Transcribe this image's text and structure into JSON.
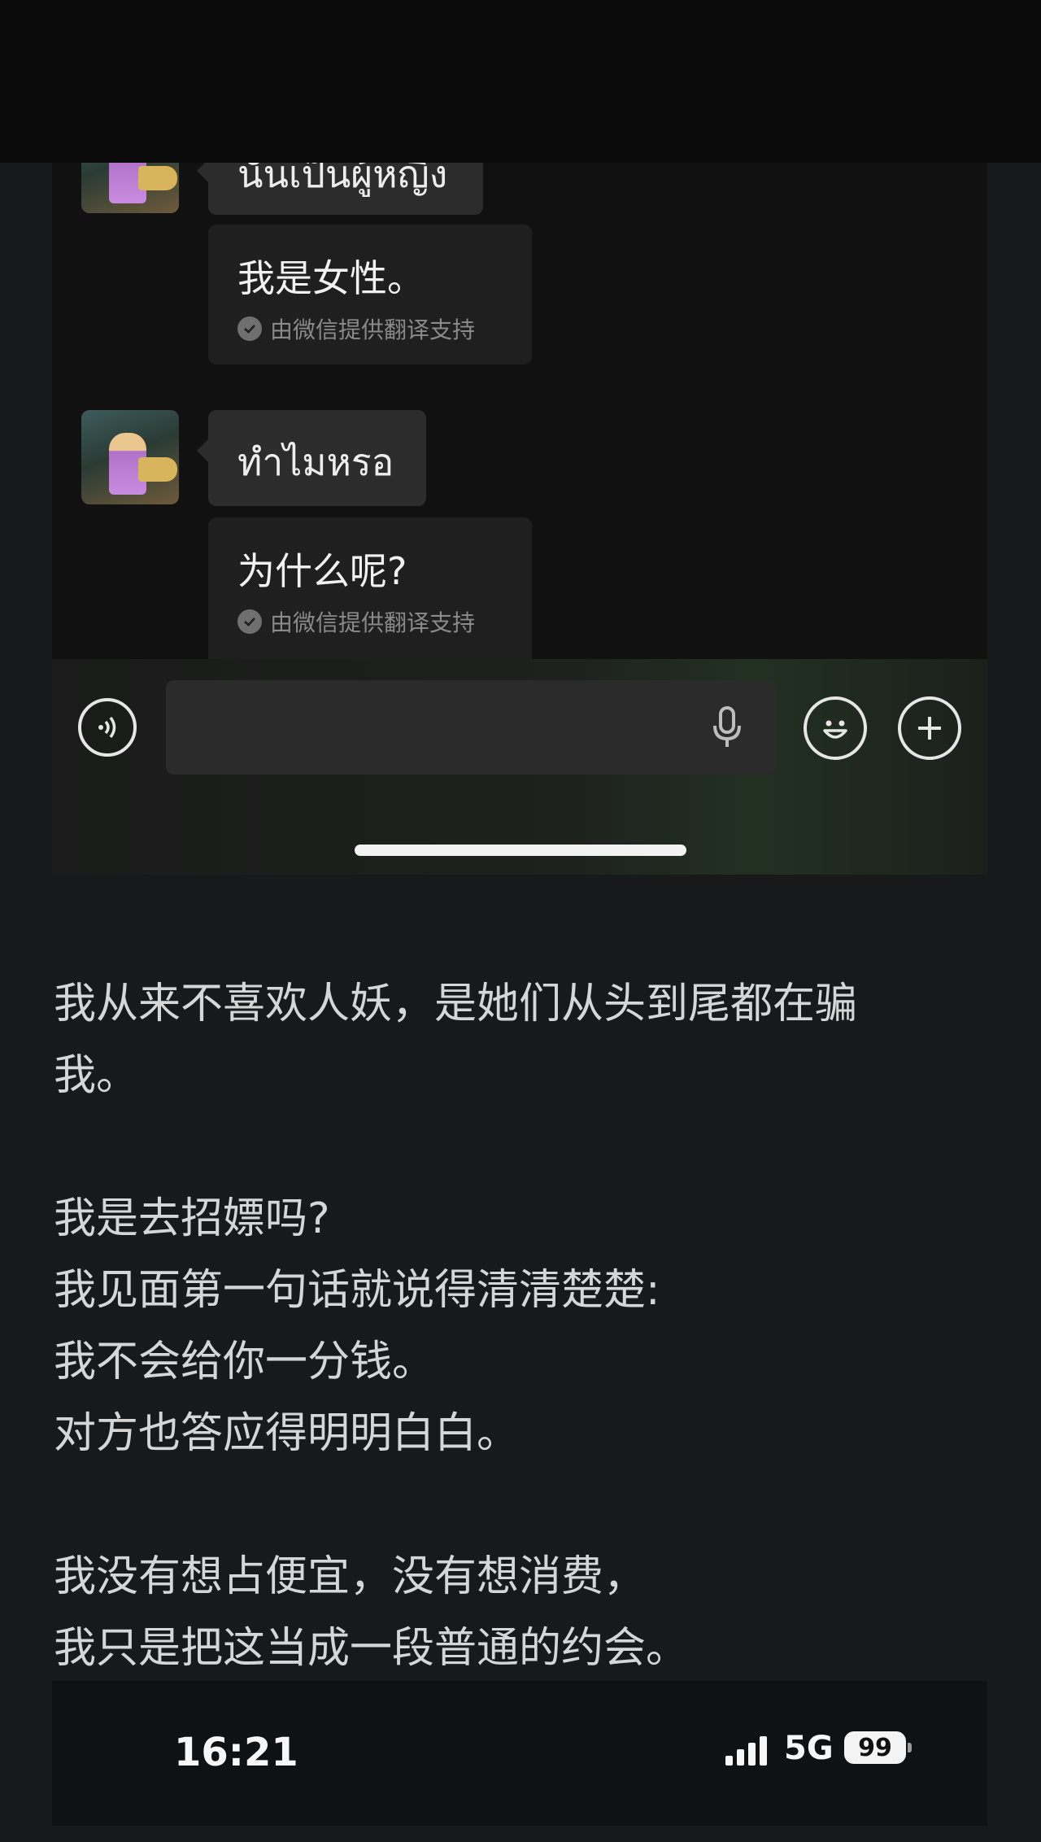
{
  "chat": {
    "messages": [
      {
        "original": "นั่นเป็นผู้หญิง",
        "translation": "我是女性。",
        "translation_credit": "由微信提供翻译支持"
      },
      {
        "original": "ทำไมหรอ",
        "translation": "为什么呢?",
        "translation_credit": "由微信提供翻译支持"
      }
    ]
  },
  "input_bar": {
    "voice_icon": "voice-waves-icon",
    "mic_icon": "microphone-icon",
    "emoji_icon": "smiley-icon",
    "plus_icon": "plus-circle-icon",
    "input_value": ""
  },
  "article": {
    "paragraphs": [
      [
        "我从来不喜欢人妖，是她们从头到尾都在骗",
        "我。"
      ],
      [
        "我是去招嫖吗?",
        "我见面第一句话就说得清清楚楚:",
        "我不会给你一分钱。",
        "对方也答应得明明白白。"
      ],
      [
        "我没有想占便宜，没有想消费，",
        "我只是把这当成一段普通的约会。"
      ]
    ]
  },
  "status_bar": {
    "time": "16:21",
    "network": "5G",
    "battery": "99"
  }
}
